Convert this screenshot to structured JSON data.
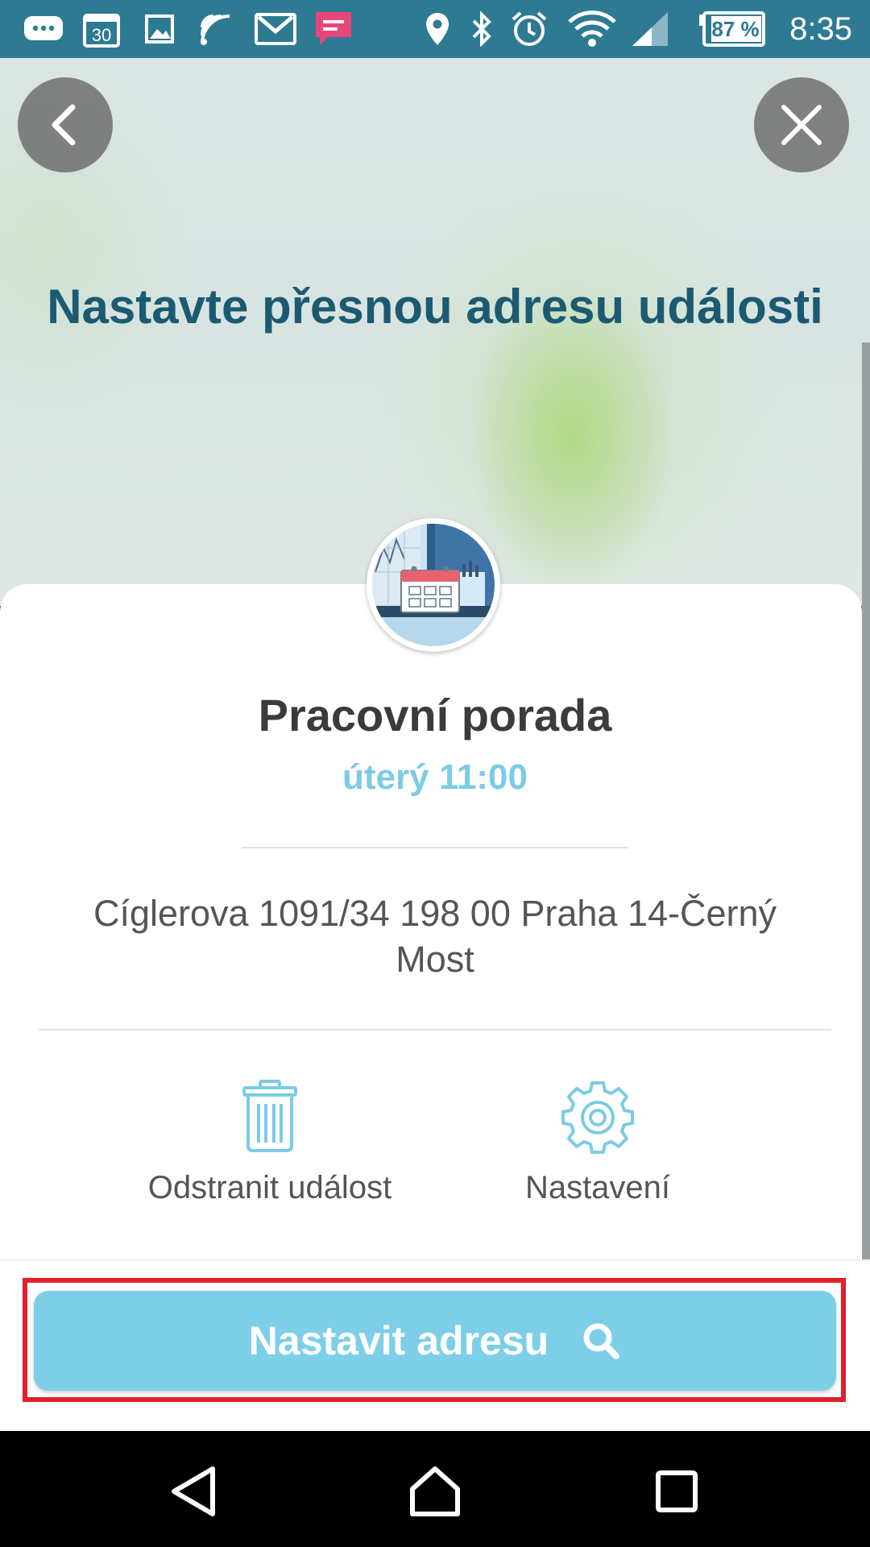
{
  "status_bar": {
    "time": "8:35",
    "battery": "87 %",
    "calendar_icon_day": "30",
    "icons": [
      "message-icon",
      "calendar-icon",
      "image-icon",
      "cast-icon",
      "gmail-icon",
      "chat-icon",
      "location-icon",
      "bluetooth-icon",
      "alarm-icon",
      "wifi-icon",
      "signal-icon",
      "battery-icon"
    ]
  },
  "header": {
    "title": "Nastavte přesnou adresu události"
  },
  "event": {
    "title": "Pracovní porada",
    "time": "úterý 11:00",
    "address": "Cíglerova 1091/34 198 00 Praha 14-Černý Most"
  },
  "actions": {
    "delete_label": "Odstranit událost",
    "settings_label": "Nastavení"
  },
  "cta": {
    "label": "Nastavit adresu"
  },
  "colors": {
    "status_bar": "#2e7a93",
    "title": "#1b5a72",
    "accent": "#7dcfe8",
    "highlight": "#e0202c"
  }
}
